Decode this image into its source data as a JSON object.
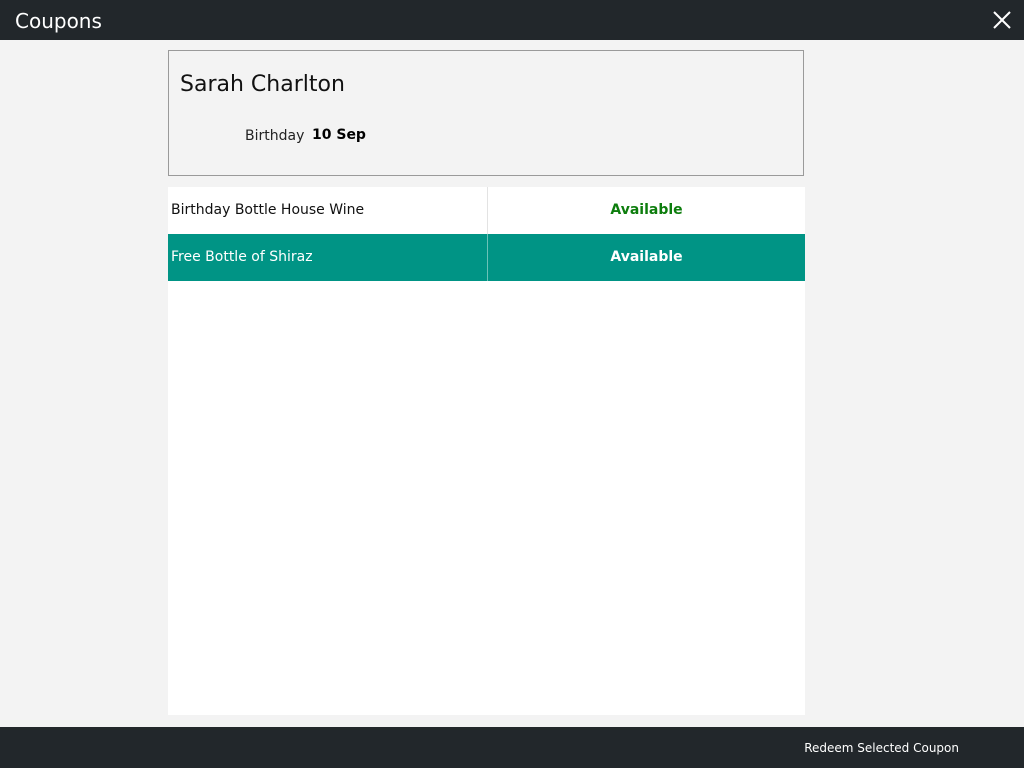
{
  "window": {
    "title": "Coupons",
    "close_icon": "close-icon"
  },
  "customer": {
    "name": "Sarah Charlton",
    "birthday_label": "Birthday",
    "birthday_value": "10 Sep"
  },
  "coupons": [
    {
      "name": "Birthday Bottle House Wine",
      "status": "Available",
      "selected": false
    },
    {
      "name": "Free Bottle of Shiraz",
      "status": "Available",
      "selected": true
    }
  ],
  "footer": {
    "redeem_label": "Redeem Selected Coupon"
  },
  "colors": {
    "titlebar": "#22272b",
    "selected_row": "#009485",
    "available_status": "#0d7d0d",
    "background": "#f3f3f3"
  }
}
